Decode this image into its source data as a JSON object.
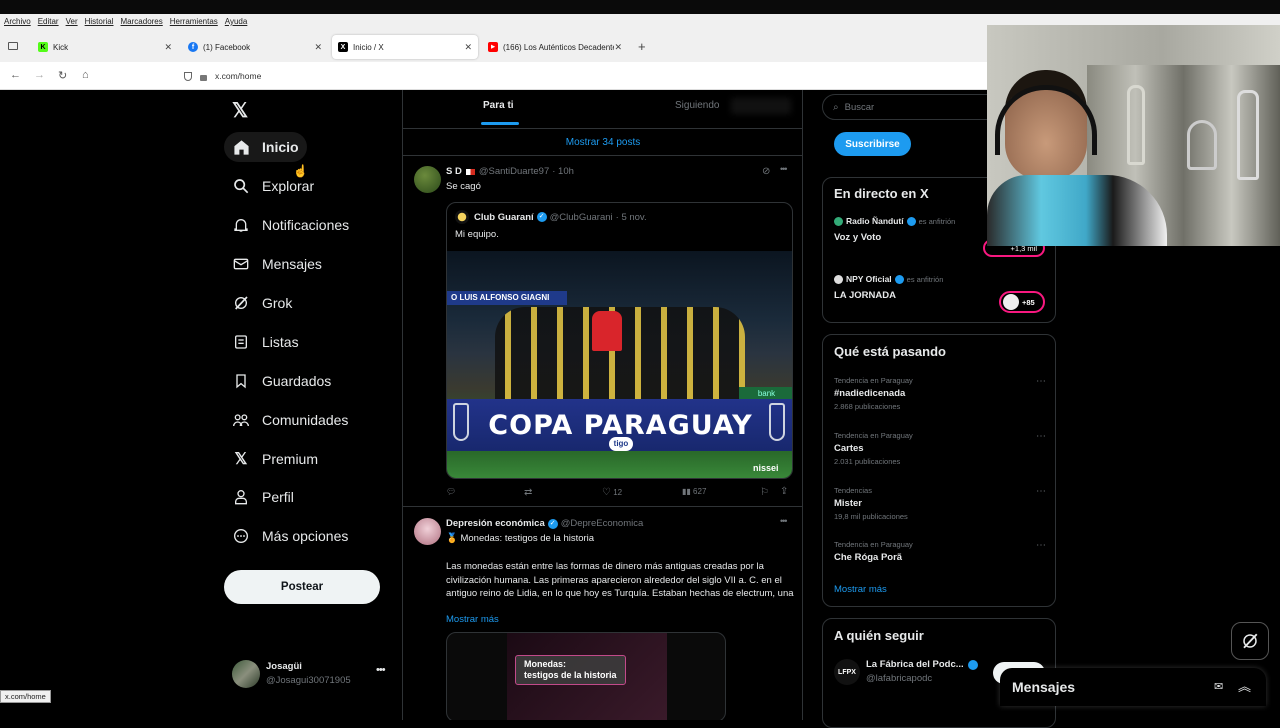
{
  "browser": {
    "menu": [
      "Archivo",
      "Editar",
      "Ver",
      "Historial",
      "Marcadores",
      "Herramientas",
      "Ayuda"
    ],
    "tabs": [
      {
        "title": "Kick",
        "favicon": "kick-icon",
        "color": "#53fc18"
      },
      {
        "title": "(1) Facebook",
        "favicon": "facebook-icon",
        "color": "#1877f2"
      },
      {
        "title": "Inicio / X",
        "favicon": "x-icon",
        "color": "#000000"
      },
      {
        "title": "(166) Los Auténticos Decadentes",
        "favicon": "youtube-icon",
        "color": "#ff0000"
      }
    ],
    "url": "x.com/home",
    "status_url": "x.com/home"
  },
  "nav": {
    "items": [
      {
        "label": "Inicio",
        "icon": "home-icon",
        "active": true
      },
      {
        "label": "Explorar",
        "icon": "search-icon"
      },
      {
        "label": "Notificaciones",
        "icon": "bell-icon"
      },
      {
        "label": "Mensajes",
        "icon": "mail-icon"
      },
      {
        "label": "Grok",
        "icon": "grok-icon"
      },
      {
        "label": "Listas",
        "icon": "list-icon"
      },
      {
        "label": "Guardados",
        "icon": "bookmark-icon"
      },
      {
        "label": "Comunidades",
        "icon": "communities-icon"
      },
      {
        "label": "Premium",
        "icon": "x-icon"
      },
      {
        "label": "Perfil",
        "icon": "person-icon"
      },
      {
        "label": "Más opciones",
        "icon": "more-circle-icon"
      }
    ],
    "post_label": "Postear",
    "account": {
      "name": "Josagüi",
      "handle": "@Josagui30071905"
    }
  },
  "feed": {
    "tabs": [
      "Para ti",
      "Siguiendo"
    ],
    "show_posts": "Mostrar 34 posts",
    "post1": {
      "name": "S D",
      "handle": "@SantiDuarte97",
      "time": "· 10h",
      "text": "Se cagó",
      "quote": {
        "name": "Club Guaraní",
        "handle": "@ClubGuarani",
        "time": "· 5 nov.",
        "text": "Mi equipo.",
        "banner_top": "O LUIS ALFONSO GIAGNI",
        "banner": "COPA PARAGUAY",
        "sponsor": "tigo",
        "sponsor2": "nissei",
        "sponsor3": "bank"
      },
      "likes": "12",
      "views": "627"
    },
    "post2": {
      "name": "Depresión económica",
      "handle": "@DepreEconomica",
      "title": "🏅 Monedas: testigos de la historia",
      "body": "Las monedas están entre las formas de dinero más antiguas creadas por la civilización humana. Las primeras aparecieron alrededor del siglo VII a. C. en el antiguo reino de Lidia, en lo que hoy es Turquía. Estaban hechas de electrum, una",
      "more": "Mostrar más",
      "image_caption": "Monedas:\ntestigos de la historia"
    }
  },
  "right": {
    "search_placeholder": "Buscar",
    "subscribe": "Suscribirse",
    "live": {
      "title": "En directo en X",
      "items": [
        {
          "host": "Radio Ñandutí",
          "role": "es anfitrión",
          "title": "Voz y Voto",
          "count": "+1,3 mil"
        },
        {
          "host": "NPY Oficial",
          "role": "es anfitrión",
          "title": "LA JORNADA",
          "count": "+85"
        }
      ]
    },
    "trends": {
      "title": "Qué está pasando",
      "items": [
        {
          "context": "Tendencia en Paraguay",
          "name": "#nadiedicenada",
          "count": "2.868 publicaciones"
        },
        {
          "context": "Tendencia en Paraguay",
          "name": "Cartes",
          "count": "2.031 publicaciones"
        },
        {
          "context": "Tendencias",
          "name": "Mister",
          "count": "19,8 mil publicaciones"
        },
        {
          "context": "Tendencia en Paraguay",
          "name": "Che Róga Porã",
          "count": ""
        }
      ],
      "show_more": "Mostrar más"
    },
    "follow": {
      "title": "A quién seguir",
      "name": "La Fábrica del Podc...",
      "handle": "@lafabricapodc",
      "avatar_text": "LFPX"
    }
  },
  "messages_label": "Mensajes",
  "colors": {
    "accent": "#1d9bf0",
    "bg": "#000000",
    "border": "#2f3336",
    "text": "#e7e9ea",
    "muted": "#71767b",
    "live": "#f91880"
  }
}
